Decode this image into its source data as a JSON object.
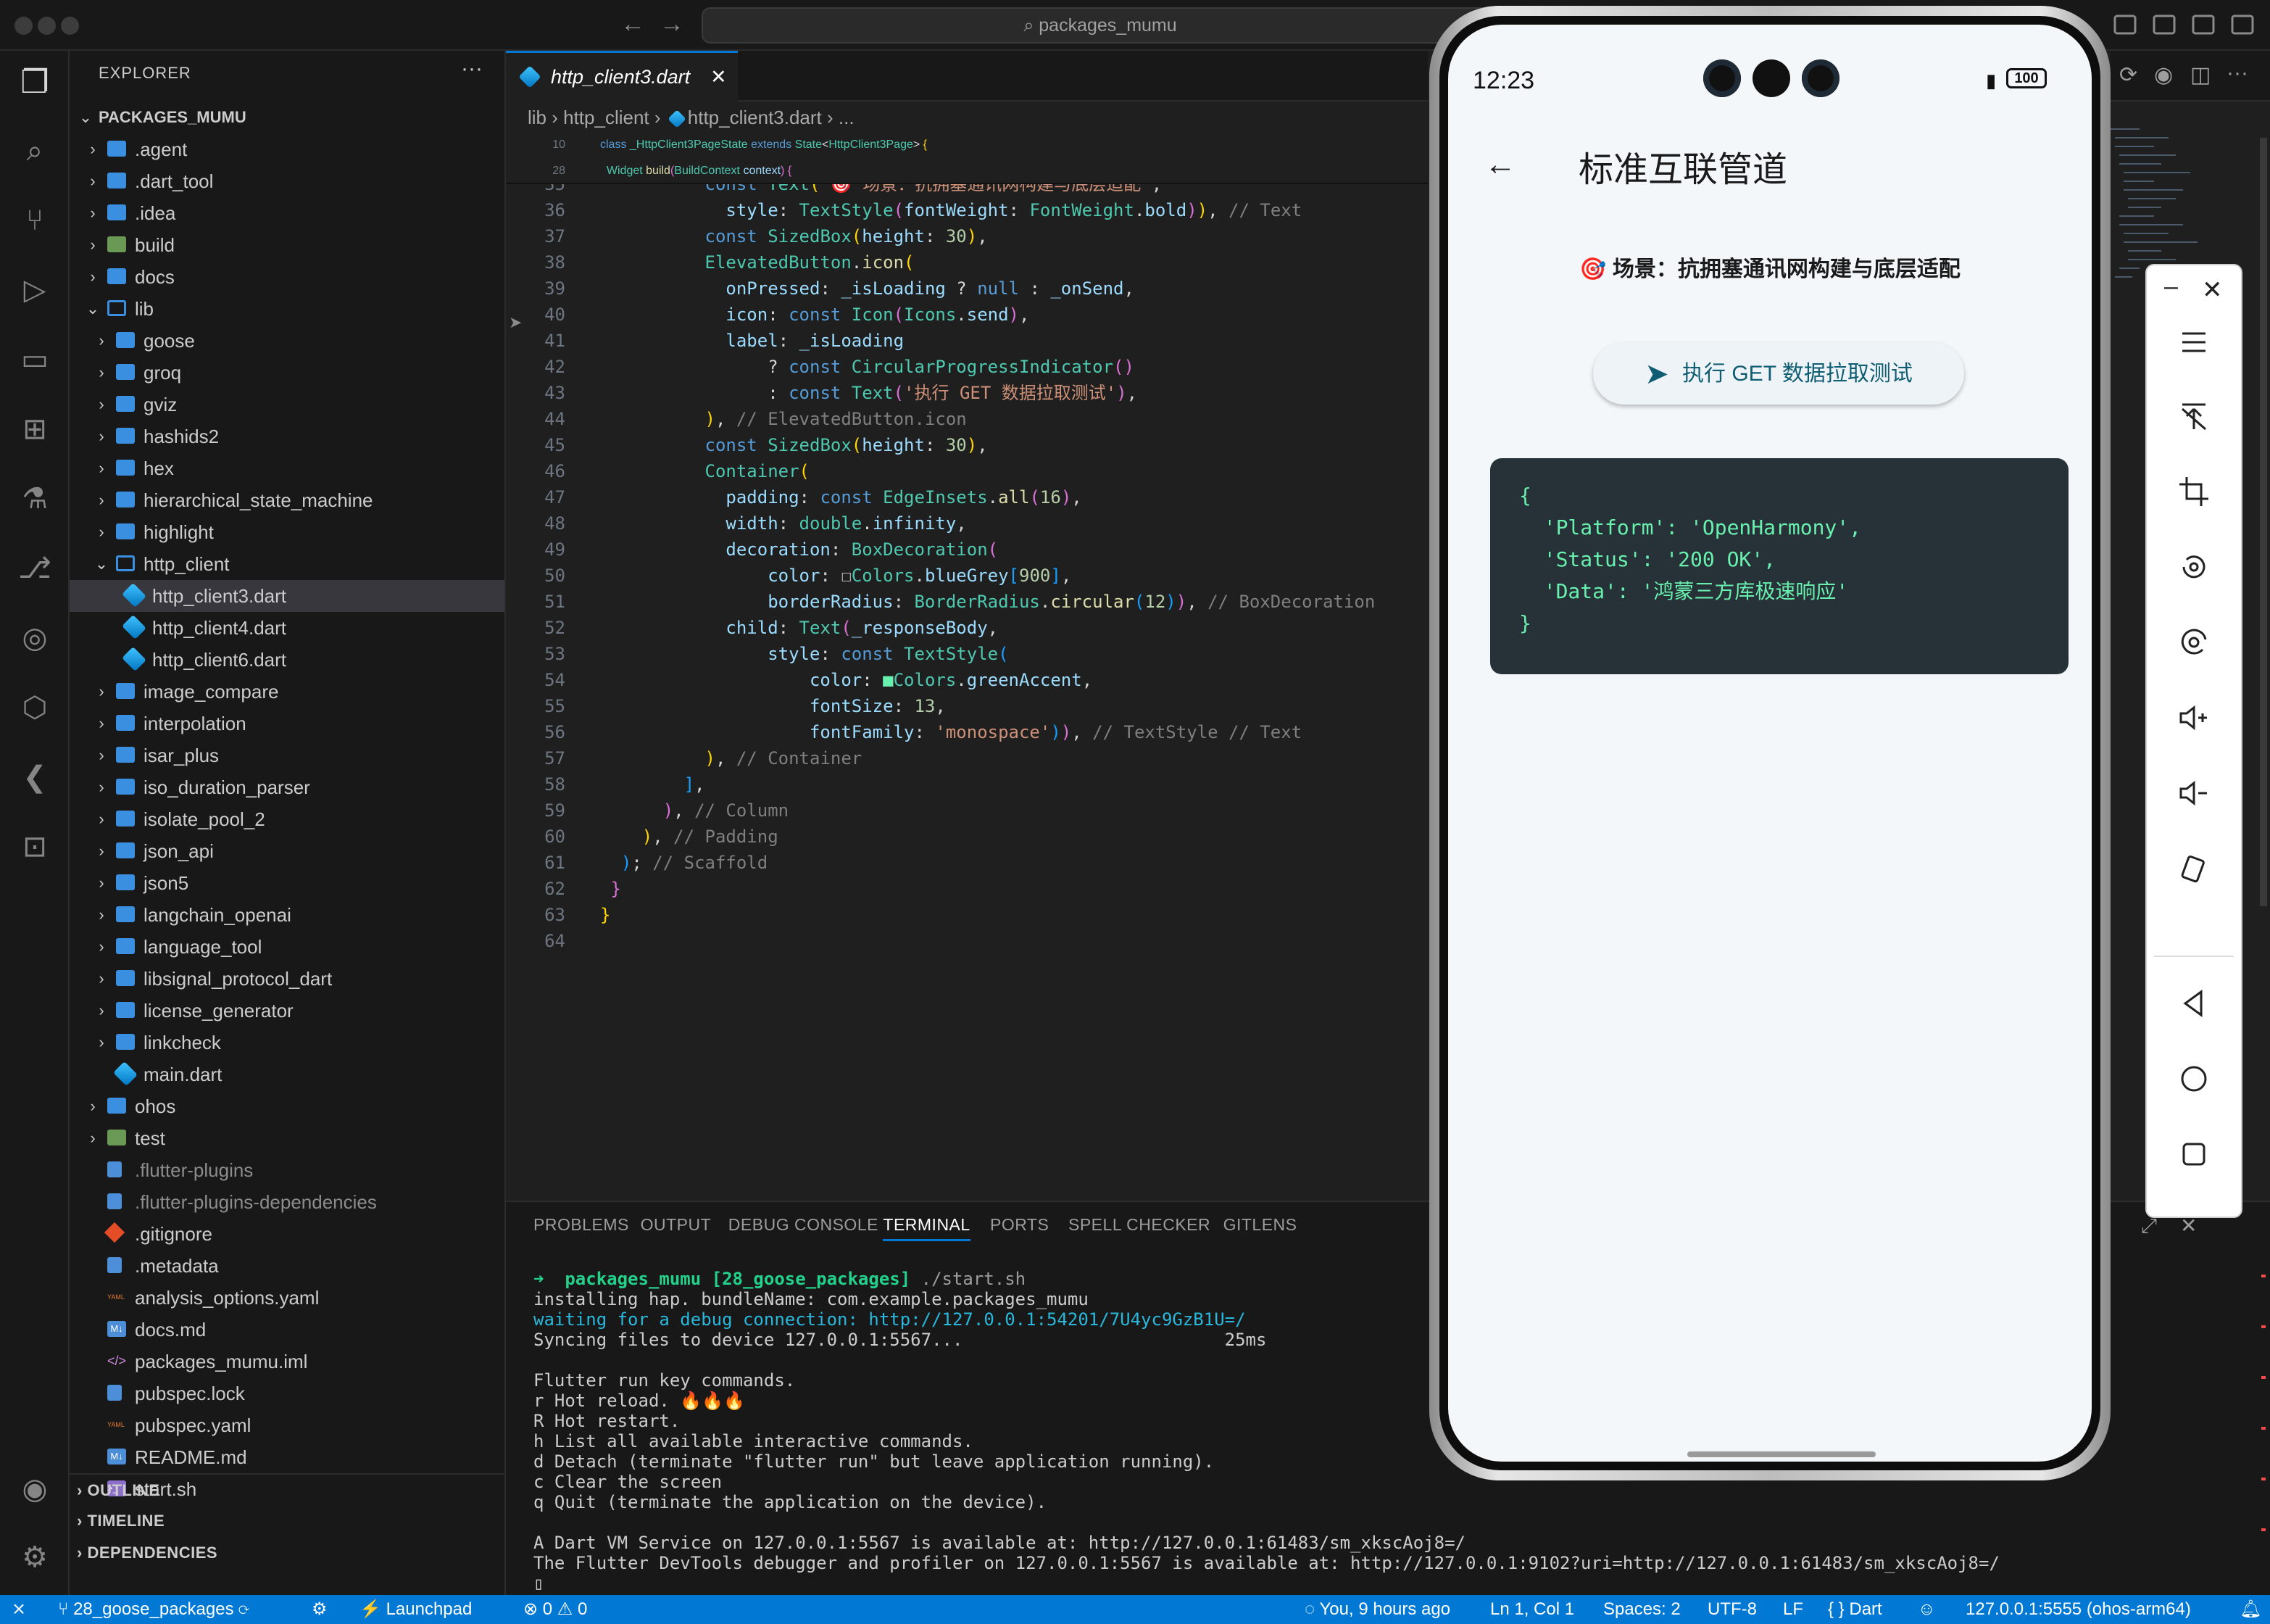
{
  "window": {
    "search_text": "packages_mumu"
  },
  "explorer": {
    "title": "EXPLORER",
    "root": "PACKAGES_MUMU",
    "items": [
      {
        "label": ".agent",
        "kind": "folder",
        "depth": 1,
        "state": "closed",
        "dim": false
      },
      {
        "label": ".dart_tool",
        "kind": "folder",
        "depth": 1,
        "state": "closed",
        "dim": false
      },
      {
        "label": ".idea",
        "kind": "folder",
        "depth": 1,
        "state": "closed",
        "dim": false
      },
      {
        "label": "build",
        "kind": "folder-special",
        "depth": 1,
        "state": "closed",
        "dim": false
      },
      {
        "label": "docs",
        "kind": "folder",
        "depth": 1,
        "state": "closed",
        "dim": false
      },
      {
        "label": "lib",
        "kind": "folder",
        "depth": 1,
        "state": "open",
        "dim": false
      },
      {
        "label": "goose",
        "kind": "folder",
        "depth": 2,
        "state": "closed",
        "dim": false
      },
      {
        "label": "groq",
        "kind": "folder",
        "depth": 2,
        "state": "closed",
        "dim": false
      },
      {
        "label": "gviz",
        "kind": "folder",
        "depth": 2,
        "state": "closed",
        "dim": false
      },
      {
        "label": "hashids2",
        "kind": "folder",
        "depth": 2,
        "state": "closed",
        "dim": false
      },
      {
        "label": "hex",
        "kind": "folder",
        "depth": 2,
        "state": "closed",
        "dim": false
      },
      {
        "label": "hierarchical_state_machine",
        "kind": "folder",
        "depth": 2,
        "state": "closed",
        "dim": false
      },
      {
        "label": "highlight",
        "kind": "folder",
        "depth": 2,
        "state": "closed",
        "dim": false
      },
      {
        "label": "http_client",
        "kind": "folder",
        "depth": 2,
        "state": "open",
        "dim": false
      },
      {
        "label": "http_client3.dart",
        "kind": "dart",
        "depth": 3,
        "state": "",
        "dim": false,
        "selected": true
      },
      {
        "label": "http_client4.dart",
        "kind": "dart",
        "depth": 3,
        "state": "",
        "dim": false
      },
      {
        "label": "http_client6.dart",
        "kind": "dart",
        "depth": 3,
        "state": "",
        "dim": false
      },
      {
        "label": "image_compare",
        "kind": "folder",
        "depth": 2,
        "state": "closed",
        "dim": false
      },
      {
        "label": "interpolation",
        "kind": "folder",
        "depth": 2,
        "state": "closed",
        "dim": false
      },
      {
        "label": "isar_plus",
        "kind": "folder",
        "depth": 2,
        "state": "closed",
        "dim": false
      },
      {
        "label": "iso_duration_parser",
        "kind": "folder",
        "depth": 2,
        "state": "closed",
        "dim": false
      },
      {
        "label": "isolate_pool_2",
        "kind": "folder",
        "depth": 2,
        "state": "closed",
        "dim": false
      },
      {
        "label": "json_api",
        "kind": "folder",
        "depth": 2,
        "state": "closed",
        "dim": false
      },
      {
        "label": "json5",
        "kind": "folder",
        "depth": 2,
        "state": "closed",
        "dim": false
      },
      {
        "label": "langchain_openai",
        "kind": "folder",
        "depth": 2,
        "state": "closed",
        "dim": false
      },
      {
        "label": "language_tool",
        "kind": "folder",
        "depth": 2,
        "state": "closed",
        "dim": false
      },
      {
        "label": "libsignal_protocol_dart",
        "kind": "folder",
        "depth": 2,
        "state": "closed",
        "dim": false
      },
      {
        "label": "license_generator",
        "kind": "folder",
        "depth": 2,
        "state": "closed",
        "dim": false
      },
      {
        "label": "linkcheck",
        "kind": "folder",
        "depth": 2,
        "state": "closed",
        "dim": false
      },
      {
        "label": "main.dart",
        "kind": "dart",
        "depth": 2,
        "state": "",
        "dim": false
      },
      {
        "label": "ohos",
        "kind": "folder",
        "depth": 1,
        "state": "closed",
        "dim": false
      },
      {
        "label": "test",
        "kind": "folder-special",
        "depth": 1,
        "state": "closed",
        "dim": false
      },
      {
        "label": ".flutter-plugins",
        "kind": "file",
        "depth": 1,
        "state": "",
        "dim": true
      },
      {
        "label": ".flutter-plugins-dependencies",
        "kind": "file",
        "depth": 1,
        "state": "",
        "dim": true
      },
      {
        "label": ".gitignore",
        "kind": "git",
        "depth": 1,
        "state": "",
        "dim": false
      },
      {
        "label": ".metadata",
        "kind": "file",
        "depth": 1,
        "state": "",
        "dim": false
      },
      {
        "label": "analysis_options.yaml",
        "kind": "yaml",
        "depth": 1,
        "state": "",
        "dim": false
      },
      {
        "label": "docs.md",
        "kind": "md",
        "depth": 1,
        "state": "",
        "dim": false
      },
      {
        "label": "packages_mumu.iml",
        "kind": "xml",
        "depth": 1,
        "state": "",
        "dim": false
      },
      {
        "label": "pubspec.lock",
        "kind": "file",
        "depth": 1,
        "state": "",
        "dim": false
      },
      {
        "label": "pubspec.yaml",
        "kind": "yaml",
        "depth": 1,
        "state": "",
        "dim": false
      },
      {
        "label": "README.md",
        "kind": "md",
        "depth": 1,
        "state": "",
        "dim": false
      },
      {
        "label": "start.sh",
        "kind": "sh",
        "depth": 1,
        "state": "",
        "dim": false
      }
    ],
    "sections": [
      "OUTLINE",
      "TIMELINE",
      "DEPENDENCIES"
    ]
  },
  "editor": {
    "tab_label": "http_client3.dart",
    "breadcrumb": [
      "lib",
      "http_client",
      "http_client3.dart",
      "..."
    ],
    "sticky": [
      {
        "n": "10",
        "html": "<span class='kw'>class</span> <span class='ty'>_HttpClient3PageState</span> <span class='kw'>extends</span> <span class='ty'>State</span><span class='pl'>&lt;</span><span class='ty'>HttpClient3Page</span><span class='pl'>&gt;</span> <span class='br1'>{</span>"
      },
      {
        "n": "28",
        "html": "  <span class='ty'>Widget</span> <span class='fn'>build</span><span class='br2'>(</span><span class='ty'>BuildContext</span> <span class='pr'>context</span><span class='br2'>)</span> <span class='br2'>{</span>"
      }
    ],
    "lines": [
      {
        "n": "35",
        "html": "          <span class='kw'>const</span> <span class='ty'>Text</span><span class='br1'>(</span><span class='st'>'🎯 场景：抗拥塞通讯网构建与底层适配'</span><span class='pl'>,</span>"
      },
      {
        "n": "36",
        "html": "            <span class='pr'>style</span><span class='pl'>:</span> <span class='ty'>TextStyle</span><span class='br2'>(</span><span class='pr'>fontWeight</span><span class='pl'>:</span> <span class='ty'>FontWeight</span><span class='pl'>.</span><span class='pr'>bold</span><span class='br2'>)</span><span class='br1'>)</span><span class='pl'>,</span> <span class='cm'>// Text</span>"
      },
      {
        "n": "37",
        "html": "          <span class='kw'>const</span> <span class='ty'>SizedBox</span><span class='br1'>(</span><span class='pr'>height</span><span class='pl'>:</span> <span class='nu'>30</span><span class='br1'>)</span><span class='pl'>,</span>"
      },
      {
        "n": "38",
        "html": "          <span class='ty'>ElevatedButton</span><span class='pl'>.</span><span class='fn'>icon</span><span class='br1'>(</span>"
      },
      {
        "n": "39",
        "html": "            <span class='pr'>onPressed</span><span class='pl'>:</span> <span class='pr'>_isLoading</span> <span class='pl'>?</span> <span class='kw'>null</span> <span class='pl'>:</span> <span class='pr'>_onSend</span><span class='pl'>,</span>"
      },
      {
        "n": "40",
        "html": "            <span class='pr'>icon</span><span class='pl'>:</span> <span class='kw'>const</span> <span class='ty'>Icon</span><span class='br2'>(</span><span class='ty'>Icons</span><span class='pl'>.</span><span class='pr'>send</span><span class='br2'>)</span><span class='pl'>,</span>"
      },
      {
        "n": "41",
        "html": "            <span class='pr'>label</span><span class='pl'>:</span> <span class='pr'>_isLoading</span>"
      },
      {
        "n": "42",
        "html": "                <span class='pl'>?</span> <span class='kw'>const</span> <span class='ty'>CircularProgressIndicator</span><span class='br2'>()</span>"
      },
      {
        "n": "43",
        "html": "                <span class='pl'>:</span> <span class='kw'>const</span> <span class='ty'>Text</span><span class='br2'>(</span><span class='st'>'执行 GET 数据拉取测试'</span><span class='br2'>)</span><span class='pl'>,</span>"
      },
      {
        "n": "44",
        "html": "          <span class='br1'>)</span><span class='pl'>,</span> <span class='cm'>// ElevatedButton.icon</span>"
      },
      {
        "n": "45",
        "html": "          <span class='kw'>const</span> <span class='ty'>SizedBox</span><span class='br1'>(</span><span class='pr'>height</span><span class='pl'>:</span> <span class='nu'>30</span><span class='br1'>)</span><span class='pl'>,</span>"
      },
      {
        "n": "46",
        "html": "          <span class='ty'>Container</span><span class='br1'>(</span>"
      },
      {
        "n": "47",
        "html": "            <span class='pr'>padding</span><span class='pl'>:</span> <span class='kw'>const</span> <span class='ty'>EdgeInsets</span><span class='pl'>.</span><span class='fn'>all</span><span class='br2'>(</span><span class='nu'>16</span><span class='br2'>)</span><span class='pl'>,</span>"
      },
      {
        "n": "48",
        "html": "            <span class='pr'>width</span><span class='pl'>:</span> <span class='ty'>double</span><span class='pl'>.</span><span class='pr'>infinity</span><span class='pl'>,</span>"
      },
      {
        "n": "49",
        "html": "            <span class='pr'>decoration</span><span class='pl'>:</span> <span class='ty'>BoxDecoration</span><span class='br2'>(</span>"
      },
      {
        "n": "50",
        "html": "                <span class='pr'>color</span><span class='pl'>:</span> <span class='pl'>☐</span><span class='ty'>Colors</span><span class='pl'>.</span><span class='pr'>blueGrey</span><span class='br3'>[</span><span class='nu'>900</span><span class='br3'>]</span><span class='pl'>,</span>"
      },
      {
        "n": "51",
        "html": "                <span class='pr'>borderRadius</span><span class='pl'>:</span> <span class='ty'>BorderRadius</span><span class='pl'>.</span><span class='fn'>circular</span><span class='br3'>(</span><span class='nu'>12</span><span class='br3'>)</span><span class='br2'>)</span><span class='pl'>,</span> <span class='cm'>// BoxDecoration</span>"
      },
      {
        "n": "52",
        "html": "            <span class='pr'>child</span><span class='pl'>:</span> <span class='ty'>Text</span><span class='br2'>(</span><span class='pr'>_responseBody</span><span class='pl'>,</span>"
      },
      {
        "n": "53",
        "html": "                <span class='pr'>style</span><span class='pl'>:</span> <span class='kw'>const</span> <span class='ty'>TextStyle</span><span class='br3'>(</span>"
      },
      {
        "n": "54",
        "html": "                    <span class='pr'>color</span><span class='pl'>:</span> <span style='color:#69f0ae'>■</span><span class='ty'>Colors</span><span class='pl'>.</span><span class='pr'>greenAccent</span><span class='pl'>,</span>"
      },
      {
        "n": "55",
        "html": "                    <span class='pr'>fontSize</span><span class='pl'>:</span> <span class='nu'>13</span><span class='pl'>,</span>"
      },
      {
        "n": "56",
        "html": "                    <span class='pr'>fontFamily</span><span class='pl'>:</span> <span class='st'>'monospace'</span><span class='br3'>)</span><span class='br2'>)</span><span class='pl'>,</span> <span class='cm'>// TextStyle // Text</span>"
      },
      {
        "n": "57",
        "html": "          <span class='br1'>)</span><span class='pl'>,</span> <span class='cm'>// Container</span>"
      },
      {
        "n": "58",
        "html": "        <span class='br3'>]</span><span class='pl'>,</span>"
      },
      {
        "n": "59",
        "html": "      <span class='br2'>)</span><span class='pl'>,</span> <span class='cm'>// Column</span>"
      },
      {
        "n": "60",
        "html": "    <span class='br1'>)</span><span class='pl'>,</span> <span class='cm'>// Padding</span>"
      },
      {
        "n": "61",
        "html": "  <span class='br3'>)</span><span class='pl'>;</span> <span class='cm'>// Scaffold</span>"
      },
      {
        "n": "62",
        "html": " <span class='br2'>}</span>"
      },
      {
        "n": "63",
        "html": "<span class='br1'>}</span>"
      },
      {
        "n": "64",
        "html": ""
      }
    ]
  },
  "panel": {
    "tabs": [
      "PROBLEMS",
      "OUTPUT",
      "DEBUG CONSOLE",
      "TERMINAL",
      "PORTS",
      "SPELL CHECKER",
      "GITLENS"
    ],
    "active_tab": "TERMINAL",
    "terminal": [
      {
        "text": "➜  packages_mumu [28_goose_packages] ./start.sh",
        "color": "prompt"
      },
      {
        "text": "installing hap. bundleName: com.example.packages_mumu",
        "color": "normal"
      },
      {
        "text": "waiting for a debug connection: http://127.0.0.1:54201/7U4yc9GzB1U=/",
        "color": "link"
      },
      {
        "text": "Syncing files to device 127.0.0.1:5567...                         25ms",
        "color": "normal"
      },
      {
        "text": "",
        "color": "normal"
      },
      {
        "text": "Flutter run key commands.",
        "color": "normal"
      },
      {
        "text": "r Hot reload. 🔥🔥🔥",
        "color": "normal"
      },
      {
        "text": "R Hot restart.",
        "color": "normal"
      },
      {
        "text": "h List all available interactive commands.",
        "color": "normal"
      },
      {
        "text": "d Detach (terminate \"flutter run\" but leave application running).",
        "color": "normal"
      },
      {
        "text": "c Clear the screen",
        "color": "normal"
      },
      {
        "text": "q Quit (terminate the application on the device).",
        "color": "normal"
      },
      {
        "text": "",
        "color": "normal"
      },
      {
        "text": "A Dart VM Service on 127.0.0.1:5567 is available at: http://127.0.0.1:61483/sm_xkscAoj8=/",
        "color": "normal"
      },
      {
        "text": "The Flutter DevTools debugger and profiler on 127.0.0.1:5567 is available at: http://127.0.0.1:9102?uri=http://127.0.0.1:61483/sm_xkscAoj8=/",
        "color": "normal"
      },
      {
        "text": "▯",
        "color": "normal"
      }
    ]
  },
  "statusbar": {
    "branch": "28_goose_packages",
    "launchpad": "Launchpad",
    "errors": "0",
    "warnings": "0",
    "blame": "You, 9 hours ago",
    "position": "Ln 1, Col 1",
    "spaces": "Spaces: 2",
    "encoding": "UTF-8",
    "eol": "LF",
    "language": "Dart",
    "device": "127.0.0.1:5555 (ohos-arm64)"
  },
  "phone": {
    "time": "12:23",
    "battery": "100",
    "app_title": "标准互联管道",
    "scenario": "🎯 场景：抗拥塞通讯网构建与底层适配",
    "button_label": "执行 GET 数据拉取测试",
    "response_lines": [
      "{",
      "  'Platform': 'OpenHarmony',",
      "  'Status': '200 OK',",
      "  'Data': '鸿蒙三方库极速响应'",
      "}"
    ],
    "colors": {
      "accent": "#0f5d73",
      "response_bg": "#263238",
      "response_text": "#69f0ae"
    }
  },
  "colors": {
    "statusbar": "#0078d4",
    "selection": "#37373d"
  }
}
